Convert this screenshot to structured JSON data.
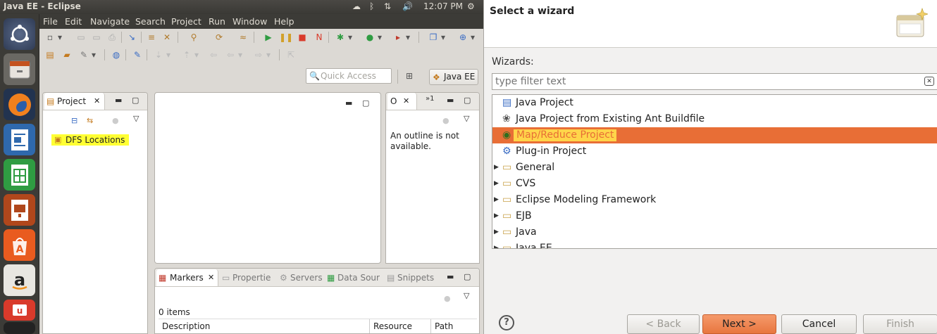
{
  "panel": {
    "window_title": "Java EE - Eclipse",
    "time": "12:07 PM"
  },
  "menu": {
    "items": [
      "File",
      "Edit",
      "Navigate",
      "Search",
      "Project",
      "Run",
      "Window",
      "Help"
    ]
  },
  "toolbar": {
    "quick_access_placeholder": "Quick Access",
    "perspective_label": "Java EE"
  },
  "project_view": {
    "tab_label": "Project",
    "tree": [
      "DFS Locations"
    ]
  },
  "outline_view": {
    "tab_label": "O",
    "overflow_label": "»1",
    "message": "An outline is not available."
  },
  "bottom_view": {
    "tabs": [
      "Markers",
      "Propertie",
      "Servers",
      "Data Sour",
      "Snippets"
    ],
    "items_count": "0 items",
    "columns": [
      "Description",
      "Resource",
      "Path"
    ]
  },
  "wizard": {
    "title": "Select a wizard",
    "wizards_label": "Wizards:",
    "filter_placeholder": "type filter text",
    "items": [
      {
        "label": "Java Project",
        "icon": "java-project-icon",
        "expandable": false,
        "selected": false
      },
      {
        "label": "Java Project from Existing Ant Buildfile",
        "icon": "ant-icon",
        "expandable": false,
        "selected": false
      },
      {
        "label": "Map/Reduce Project",
        "icon": "mapreduce-icon",
        "expandable": false,
        "selected": true
      },
      {
        "label": "Plug-in Project",
        "icon": "plugin-icon",
        "expandable": false,
        "selected": false
      },
      {
        "label": "General",
        "icon": "folder-icon",
        "expandable": true,
        "selected": false
      },
      {
        "label": "CVS",
        "icon": "folder-icon",
        "expandable": true,
        "selected": false
      },
      {
        "label": "Eclipse Modeling Framework",
        "icon": "folder-icon",
        "expandable": true,
        "selected": false
      },
      {
        "label": "EJB",
        "icon": "folder-icon",
        "expandable": true,
        "selected": false
      },
      {
        "label": "Java",
        "icon": "folder-icon",
        "expandable": true,
        "selected": false
      },
      {
        "label": "Java EE",
        "icon": "folder-icon",
        "expandable": true,
        "selected": false
      }
    ],
    "buttons": {
      "back": "< Back",
      "next": "Next >",
      "cancel": "Cancel",
      "finish": "Finish"
    }
  },
  "colors": {
    "selection": "#e86e36",
    "highlight": "#ffff33",
    "panel_bg": "#3c3b37"
  }
}
